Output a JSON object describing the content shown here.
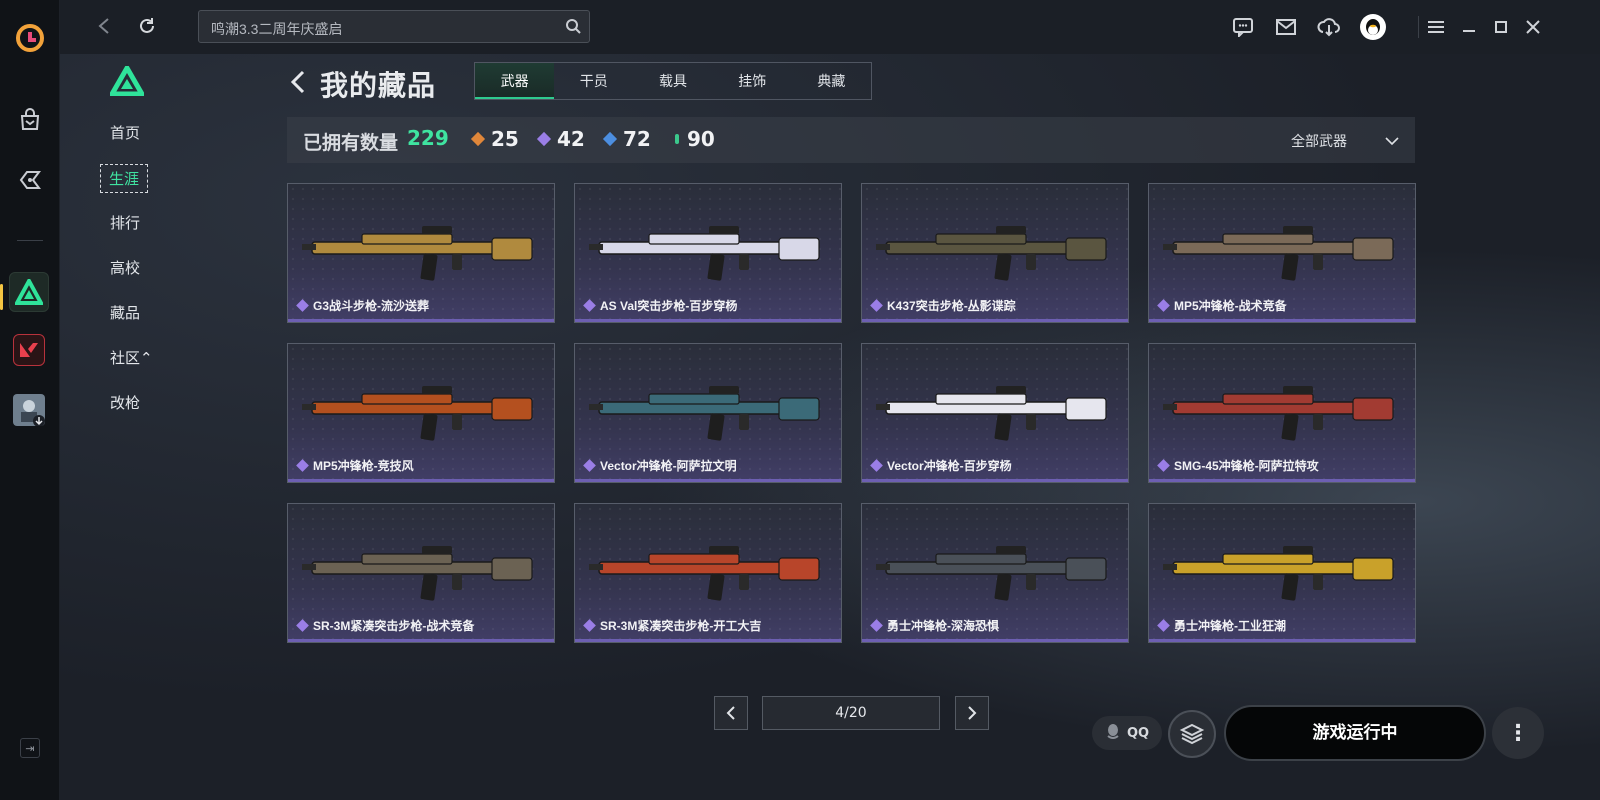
{
  "search": {
    "placeholder": "鸣潮3.3二周年庆盛启"
  },
  "sidebar": {
    "items": [
      {
        "label": "首页"
      },
      {
        "label": "生涯"
      },
      {
        "label": "排行"
      },
      {
        "label": "高校"
      },
      {
        "label": "藏品"
      },
      {
        "label": "社区⌃"
      },
      {
        "label": "改枪"
      }
    ]
  },
  "header": {
    "title": "我的藏品",
    "tabs": [
      {
        "label": "武器"
      },
      {
        "label": "干员"
      },
      {
        "label": "载具"
      },
      {
        "label": "挂饰"
      },
      {
        "label": "典藏"
      }
    ]
  },
  "stats": {
    "owned_label": "已拥有数量",
    "owned_total": "229",
    "rarity_counts": [
      {
        "value": "25",
        "color": "#e0873a"
      },
      {
        "value": "42",
        "color": "#9a7ee6"
      },
      {
        "value": "72",
        "color": "#4c8ee0"
      },
      {
        "value": "90",
        "color": "#3bc88c"
      }
    ],
    "filter_label": "全部武器"
  },
  "items": [
    {
      "name": "G3战斗步枪-流沙送葬",
      "tone": "#b08a3e"
    },
    {
      "name": "AS Val突击步枪-百步穿杨",
      "tone": "#d8d8e8"
    },
    {
      "name": "K437突击步枪-丛影谍踪",
      "tone": "#5a5540"
    },
    {
      "name": "MP5冲锋枪-战术竞备",
      "tone": "#7b6a58"
    },
    {
      "name": "MP5冲锋枪-竞技风",
      "tone": "#b4501f"
    },
    {
      "name": "Vector冲锋枪-阿萨拉文明",
      "tone": "#3b6a78"
    },
    {
      "name": "Vector冲锋枪-百步穿杨",
      "tone": "#e6e6ee"
    },
    {
      "name": "SMG-45冲锋枪-阿萨拉特攻",
      "tone": "#a23b32"
    },
    {
      "name": "SR-3M紧凑突击步枪-战术竞备",
      "tone": "#6b6253"
    },
    {
      "name": "SR-3M紧凑突击步枪-开工大吉",
      "tone": "#b8452a"
    },
    {
      "name": "勇士冲锋枪-深海恐惧",
      "tone": "#4a5058"
    },
    {
      "name": "勇士冲锋枪-工业狂潮",
      "tone": "#c9a12a"
    }
  ],
  "pagination": {
    "label": "4/20"
  },
  "bottom": {
    "qq_label": "QQ",
    "run_label": "游戏运行中"
  }
}
